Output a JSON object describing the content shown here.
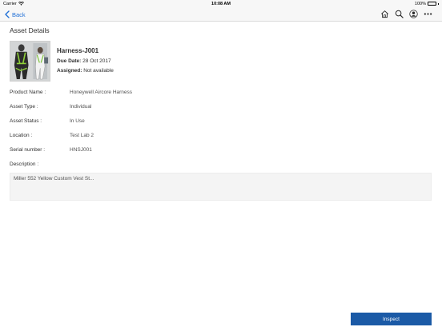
{
  "status_bar": {
    "carrier": "Carrier",
    "time": "10:08 AM",
    "battery": "100%"
  },
  "nav": {
    "back_label": "Back",
    "icons": [
      "home-icon",
      "search-icon",
      "profile-icon",
      "more-icon"
    ]
  },
  "page": {
    "title": "Asset Details"
  },
  "asset": {
    "name": "Harness-J001",
    "due_date_label": "Due Date:",
    "due_date": "28 Oct 2017",
    "assigned_label": "Assigned:",
    "assigned": "Not available"
  },
  "details": [
    {
      "label": "Product Name :",
      "value": "Honeywell Aircore Harness"
    },
    {
      "label": "Asset Type :",
      "value": "Individual"
    },
    {
      "label": "Asset Status :",
      "value": "In Use"
    },
    {
      "label": "Location :",
      "value": "Test Lab 2"
    },
    {
      "label": "Serial number :",
      "value": "HNSJ001"
    }
  ],
  "description": {
    "label": "Description :",
    "text": "Miller 552 Yellow Custom Vest St..."
  },
  "actions": {
    "inspect_label": "Inspect"
  },
  "colors": {
    "accent": "#1f6fd6",
    "button": "#1b5aa6",
    "battery": "#39c147"
  }
}
